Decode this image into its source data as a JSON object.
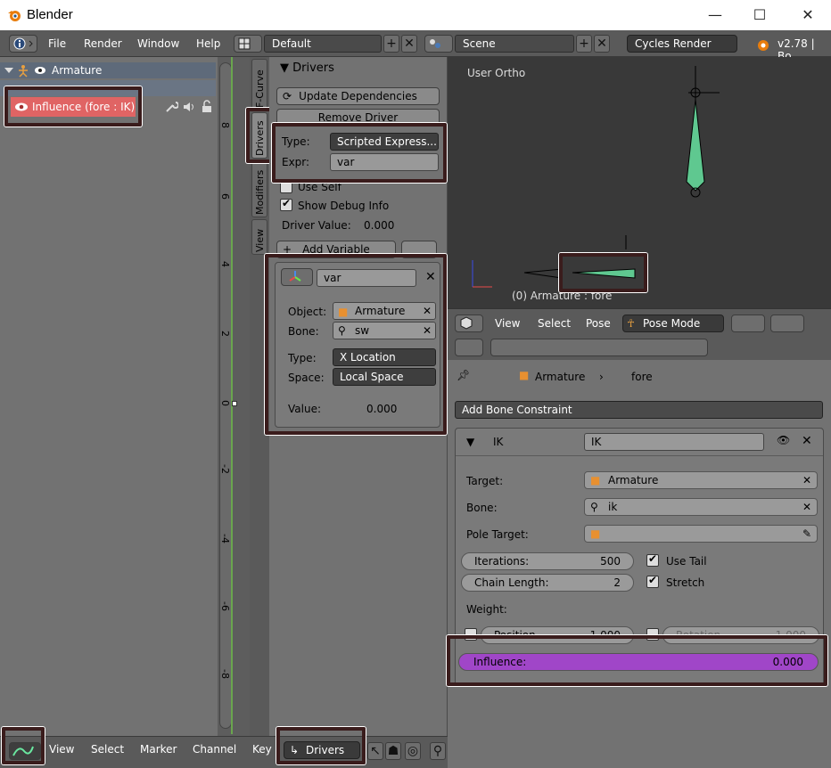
{
  "window": {
    "title": "Blender",
    "min": "—",
    "max": "☐",
    "close": "✕"
  },
  "header": {
    "menus": [
      "File",
      "Render",
      "Window",
      "Help"
    ],
    "screen": "Default",
    "scene": "Scene",
    "engine": "Cycles Render",
    "version": "v2.78 | Bo"
  },
  "outliner": {
    "armature": "Armature",
    "influence_row": "Influence (fore : IK)"
  },
  "ruler": [
    "8",
    "6",
    "4",
    "2",
    "0",
    "-2",
    "-4",
    "-6",
    "-8"
  ],
  "tabs": [
    "F-Curve",
    "Drivers",
    "Modifiers",
    "View"
  ],
  "drivers": {
    "panel_title": "Drivers",
    "update_btn": "Update Dependencies",
    "remove_btn": "Remove Driver",
    "type_label": "Type:",
    "type_value": "Scripted Express...",
    "expr_label": "Expr:",
    "expr_value": "var",
    "use_self": "Use Self",
    "show_debug": "Show Debug Info",
    "driver_value_label": "Driver Value:",
    "driver_value": "0.000",
    "add_variable": "Add Variable",
    "var_name": "var",
    "object_label": "Object:",
    "object_value": "Armature",
    "bone_label": "Bone:",
    "bone_value": "sw",
    "vtype_label": "Type:",
    "vtype_value": "X Location",
    "space_label": "Space:",
    "space_value": "Local Space",
    "value_label": "Value:",
    "value": "0.000"
  },
  "view3d": {
    "label": "User Ortho",
    "status": "(0) Armature : fore",
    "menus": [
      "View",
      "Select",
      "Pose"
    ],
    "mode": "Pose Mode"
  },
  "props": {
    "breadcrumb_object": "Armature",
    "breadcrumb_bone": "fore",
    "add_constraint": "Add Bone Constraint",
    "constraint_type": "IK",
    "constraint_name": "IK",
    "target_label": "Target:",
    "target_value": "Armature",
    "bone_label": "Bone:",
    "bone_value": "ik",
    "pole_label": "Pole Target:",
    "iterations_label": "Iterations:",
    "iterations_value": "500",
    "chain_label": "Chain Length:",
    "chain_value": "2",
    "use_tail": "Use Tail",
    "stretch": "Stretch",
    "weight_label": "Weight:",
    "position_label": "Position",
    "position_value": "1.000",
    "rotation_label": "Rotation",
    "rotation_value": "1.000",
    "influence_label": "Influence:",
    "influence_value": "0.000"
  },
  "bottom": {
    "menus": [
      "View",
      "Select",
      "Marker",
      "Channel",
      "Key"
    ],
    "mode": "Drivers"
  },
  "colors": {
    "accent_purple": "#a046c8",
    "influence_red": "#e06464",
    "bone_green": "#5fc890"
  }
}
